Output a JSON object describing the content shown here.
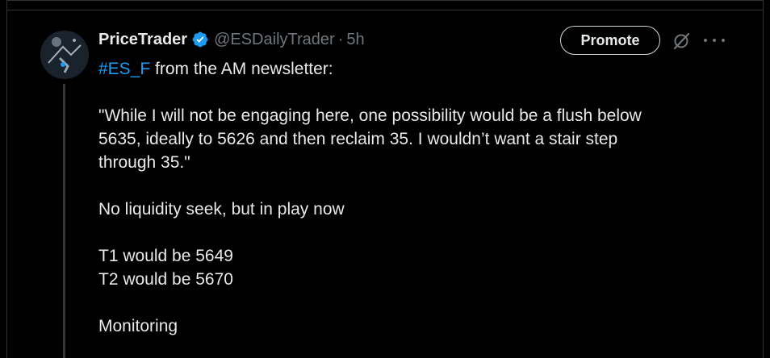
{
  "tweet": {
    "display_name": "PriceTrader",
    "handle": "@ESDailyTrader",
    "separator": "·",
    "time": "5h",
    "promote_label": "Promote",
    "hashtag": "#ES_F",
    "intro_rest": " from the AM newsletter:",
    "quote_lines": [
      "\"While I will not be engaging here, one possibility would be a flush below",
      "5635, ideally to 5626 and then reclaim 35. I wouldn’t want a stair step",
      "through 35.\""
    ],
    "liquidity_line": "No liquidity seek, but in play now",
    "targets": [
      "T1 would be 5649",
      "T2 would be 5670"
    ],
    "closing": "Monitoring"
  },
  "icons": {
    "verified": "verified-badge-icon",
    "grok": "grok-icon",
    "more": "more-options-icon"
  },
  "colors": {
    "background": "#000000",
    "text": "#e7e9ea",
    "muted": "#71767b",
    "link": "#1d9bf0",
    "verified": "#1d9bf0"
  }
}
